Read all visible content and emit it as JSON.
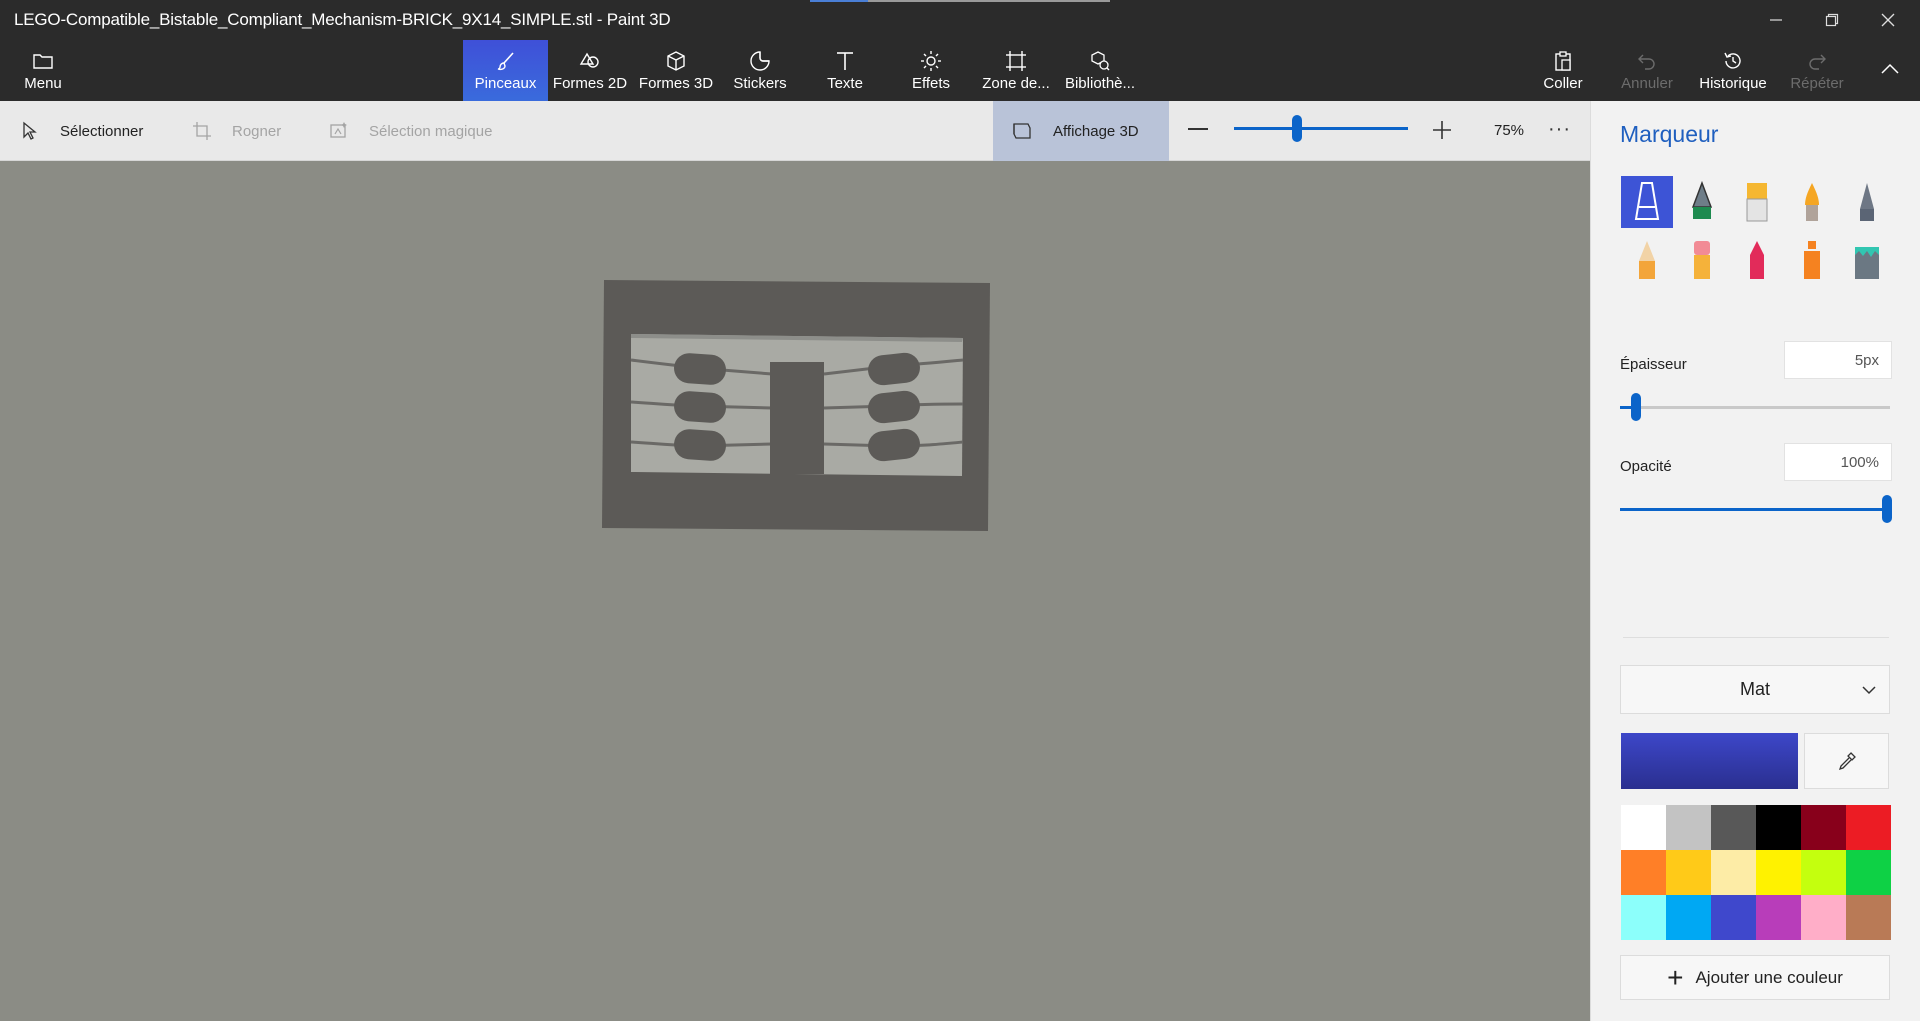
{
  "window": {
    "title": "LEGO-Compatible_Bistable_Compliant_Mechanism-BRICK_9X14_SIMPLE.stl - Paint 3D"
  },
  "ribbon": {
    "menu_label": "Menu",
    "tabs": [
      {
        "label": "Pinceaux",
        "icon": "brush-icon",
        "active": true
      },
      {
        "label": "Formes 2D",
        "icon": "shapes-2d-icon"
      },
      {
        "label": "Formes 3D",
        "icon": "cube-icon"
      },
      {
        "label": "Stickers",
        "icon": "sticker-icon"
      },
      {
        "label": "Texte",
        "icon": "text-icon"
      },
      {
        "label": "Effets",
        "icon": "sun-icon"
      },
      {
        "label": "Zone de...",
        "icon": "crop-canvas-icon"
      },
      {
        "label": "Bibliothè...",
        "icon": "library-icon"
      }
    ],
    "actions": [
      {
        "label": "Coller",
        "icon": "paste-icon",
        "enabled": true
      },
      {
        "label": "Annuler",
        "icon": "undo-icon",
        "enabled": false
      },
      {
        "label": "Historique",
        "icon": "history-icon",
        "enabled": true
      },
      {
        "label": "Répéter",
        "icon": "redo-icon",
        "enabled": false
      }
    ]
  },
  "toolbar": {
    "select_label": "Sélectionner",
    "crop_label": "Rogner",
    "magic_select_label": "Sélection magique",
    "view3d_label": "Affichage 3D",
    "zoom_value": "75%",
    "zoom_level": 0.33
  },
  "panel": {
    "title": "Marqueur",
    "brushes": [
      {
        "name": "marker",
        "selected": true
      },
      {
        "name": "calligraphy-pen"
      },
      {
        "name": "oil-brush"
      },
      {
        "name": "watercolor"
      },
      {
        "name": "pixel-pen"
      },
      {
        "name": "pencil"
      },
      {
        "name": "eraser"
      },
      {
        "name": "crayon"
      },
      {
        "name": "spray-can"
      },
      {
        "name": "fill-bucket"
      }
    ],
    "thickness_label": "Épaisseur",
    "thickness_value": "5px",
    "thickness_level": 0.06,
    "opacity_label": "Opacité",
    "opacity_value": "100%",
    "opacity_level": 1.0,
    "finish_value": "Mat",
    "current_color": "#3d47c9",
    "palette": [
      "#ffffff",
      "#c3c3c3",
      "#585858",
      "#000000",
      "#88001b",
      "#ec1c24",
      "#ff7f27",
      "#ffca18",
      "#fdeca6",
      "#fff200",
      "#c4ff0e",
      "#0ed145",
      "#8cfffb",
      "#00a8f3",
      "#3f48cc",
      "#b83dba",
      "#ffaec8",
      "#b97a56"
    ],
    "add_color_label": "Ajouter une couleur"
  }
}
